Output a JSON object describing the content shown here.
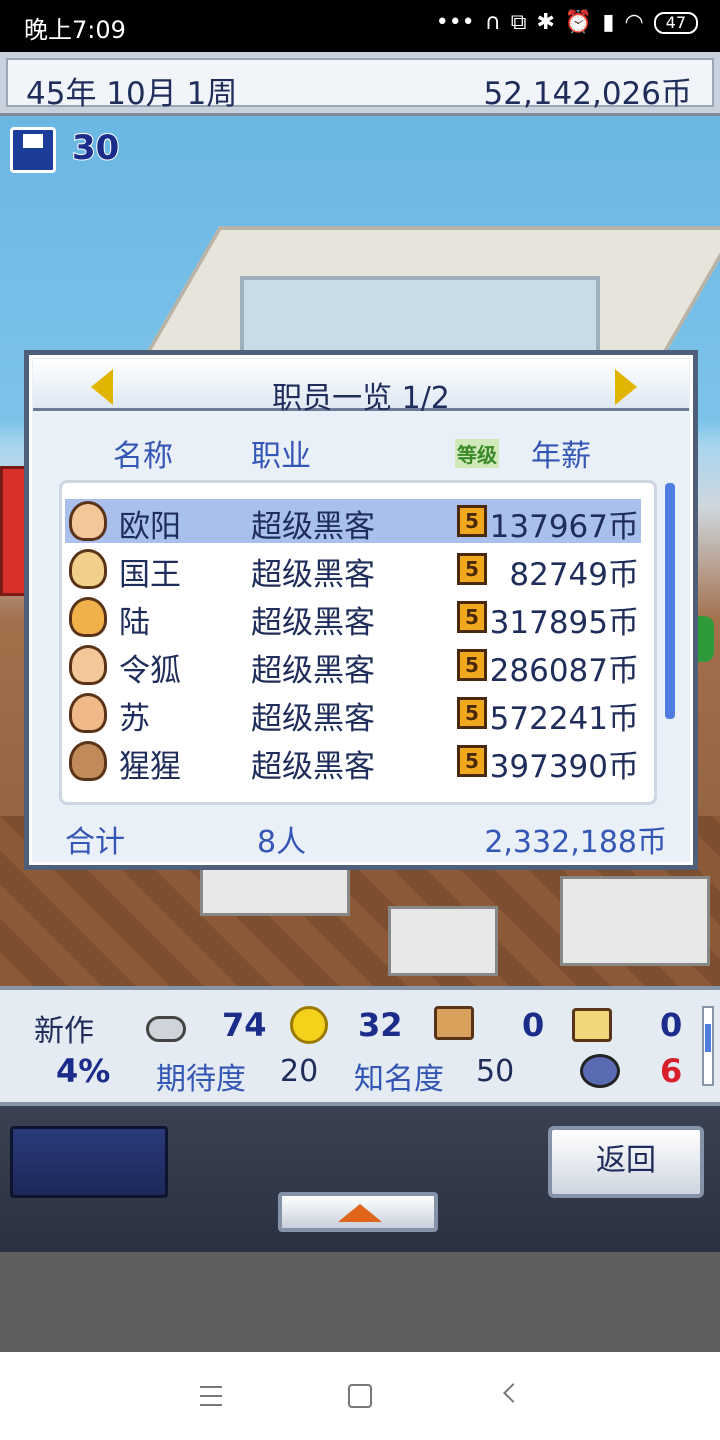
{
  "status_bar": {
    "time": "晚上7:09",
    "icons": [
      "dots-icon",
      "headphone-icon",
      "copy-icon",
      "bluetooth-icon",
      "alarm-icon",
      "signal-icon",
      "wifi-icon"
    ],
    "battery": "47"
  },
  "top": {
    "date": "45年 10月 1周",
    "money": "52,142,026币"
  },
  "save": {
    "count": "30"
  },
  "staff_panel": {
    "title": "职员一览 1/2",
    "columns": {
      "name": "名称",
      "job": "职业",
      "level_tag": "等级",
      "salary": "年薪"
    },
    "rows": [
      {
        "name": "欧阳",
        "job": "超级黑客",
        "level": "5",
        "salary": "137967币",
        "selected": true
      },
      {
        "name": "国王",
        "job": "超级黑客",
        "level": "5",
        "salary": "82749币",
        "selected": false
      },
      {
        "name": "陆",
        "job": "超级黑客",
        "level": "5",
        "salary": "317895币",
        "selected": false
      },
      {
        "name": "令狐",
        "job": "超级黑客",
        "level": "5",
        "salary": "286087币",
        "selected": false
      },
      {
        "name": "苏",
        "job": "超级黑客",
        "level": "5",
        "salary": "572241币",
        "selected": false
      },
      {
        "name": "猩猩",
        "job": "超级黑客",
        "level": "5",
        "salary": "397390币",
        "selected": false
      }
    ],
    "total": {
      "label": "合计",
      "count": "8人",
      "sum": "2,332,188币"
    }
  },
  "info_bar": {
    "new_work_label": "新作",
    "progress": "4%",
    "fun": "74",
    "creativity": "32",
    "graphics": "0",
    "sound": "0",
    "expectation_label": "期待度",
    "expectation_value": "20",
    "fame_label": "知名度",
    "fame_value": "50",
    "bugs": "6"
  },
  "controls": {
    "back_label": "返回"
  }
}
